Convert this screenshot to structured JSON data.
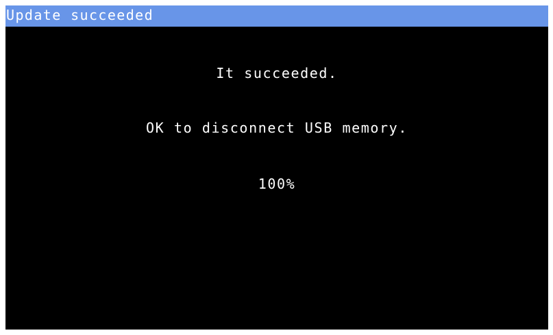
{
  "window": {
    "title": "Update succeeded"
  },
  "content": {
    "status_message": "It succeeded.",
    "instruction_message": "OK to disconnect USB memory.",
    "progress_text": "100%"
  },
  "progress": {
    "value": 1.0
  },
  "colors": {
    "title_bar": "#6895e8",
    "background": "#000000",
    "text": "#ffffff"
  }
}
